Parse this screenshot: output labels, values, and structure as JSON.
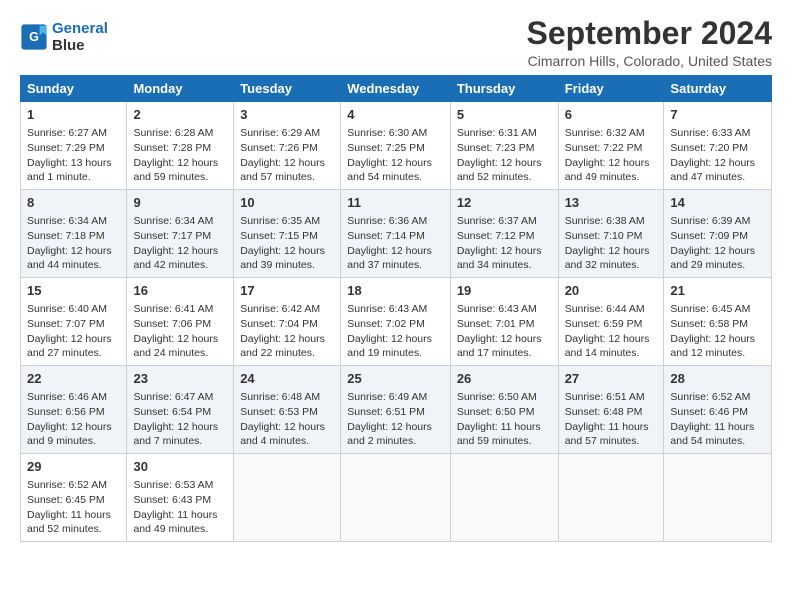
{
  "header": {
    "logo_line1": "General",
    "logo_line2": "Blue",
    "month_title": "September 2024",
    "subtitle": "Cimarron Hills, Colorado, United States"
  },
  "weekdays": [
    "Sunday",
    "Monday",
    "Tuesday",
    "Wednesday",
    "Thursday",
    "Friday",
    "Saturday"
  ],
  "weeks": [
    [
      {
        "day": "1",
        "info": "Sunrise: 6:27 AM\nSunset: 7:29 PM\nDaylight: 13 hours\nand 1 minute."
      },
      {
        "day": "2",
        "info": "Sunrise: 6:28 AM\nSunset: 7:28 PM\nDaylight: 12 hours\nand 59 minutes."
      },
      {
        "day": "3",
        "info": "Sunrise: 6:29 AM\nSunset: 7:26 PM\nDaylight: 12 hours\nand 57 minutes."
      },
      {
        "day": "4",
        "info": "Sunrise: 6:30 AM\nSunset: 7:25 PM\nDaylight: 12 hours\nand 54 minutes."
      },
      {
        "day": "5",
        "info": "Sunrise: 6:31 AM\nSunset: 7:23 PM\nDaylight: 12 hours\nand 52 minutes."
      },
      {
        "day": "6",
        "info": "Sunrise: 6:32 AM\nSunset: 7:22 PM\nDaylight: 12 hours\nand 49 minutes."
      },
      {
        "day": "7",
        "info": "Sunrise: 6:33 AM\nSunset: 7:20 PM\nDaylight: 12 hours\nand 47 minutes."
      }
    ],
    [
      {
        "day": "8",
        "info": "Sunrise: 6:34 AM\nSunset: 7:18 PM\nDaylight: 12 hours\nand 44 minutes."
      },
      {
        "day": "9",
        "info": "Sunrise: 6:34 AM\nSunset: 7:17 PM\nDaylight: 12 hours\nand 42 minutes."
      },
      {
        "day": "10",
        "info": "Sunrise: 6:35 AM\nSunset: 7:15 PM\nDaylight: 12 hours\nand 39 minutes."
      },
      {
        "day": "11",
        "info": "Sunrise: 6:36 AM\nSunset: 7:14 PM\nDaylight: 12 hours\nand 37 minutes."
      },
      {
        "day": "12",
        "info": "Sunrise: 6:37 AM\nSunset: 7:12 PM\nDaylight: 12 hours\nand 34 minutes."
      },
      {
        "day": "13",
        "info": "Sunrise: 6:38 AM\nSunset: 7:10 PM\nDaylight: 12 hours\nand 32 minutes."
      },
      {
        "day": "14",
        "info": "Sunrise: 6:39 AM\nSunset: 7:09 PM\nDaylight: 12 hours\nand 29 minutes."
      }
    ],
    [
      {
        "day": "15",
        "info": "Sunrise: 6:40 AM\nSunset: 7:07 PM\nDaylight: 12 hours\nand 27 minutes."
      },
      {
        "day": "16",
        "info": "Sunrise: 6:41 AM\nSunset: 7:06 PM\nDaylight: 12 hours\nand 24 minutes."
      },
      {
        "day": "17",
        "info": "Sunrise: 6:42 AM\nSunset: 7:04 PM\nDaylight: 12 hours\nand 22 minutes."
      },
      {
        "day": "18",
        "info": "Sunrise: 6:43 AM\nSunset: 7:02 PM\nDaylight: 12 hours\nand 19 minutes."
      },
      {
        "day": "19",
        "info": "Sunrise: 6:43 AM\nSunset: 7:01 PM\nDaylight: 12 hours\nand 17 minutes."
      },
      {
        "day": "20",
        "info": "Sunrise: 6:44 AM\nSunset: 6:59 PM\nDaylight: 12 hours\nand 14 minutes."
      },
      {
        "day": "21",
        "info": "Sunrise: 6:45 AM\nSunset: 6:58 PM\nDaylight: 12 hours\nand 12 minutes."
      }
    ],
    [
      {
        "day": "22",
        "info": "Sunrise: 6:46 AM\nSunset: 6:56 PM\nDaylight: 12 hours\nand 9 minutes."
      },
      {
        "day": "23",
        "info": "Sunrise: 6:47 AM\nSunset: 6:54 PM\nDaylight: 12 hours\nand 7 minutes."
      },
      {
        "day": "24",
        "info": "Sunrise: 6:48 AM\nSunset: 6:53 PM\nDaylight: 12 hours\nand 4 minutes."
      },
      {
        "day": "25",
        "info": "Sunrise: 6:49 AM\nSunset: 6:51 PM\nDaylight: 12 hours\nand 2 minutes."
      },
      {
        "day": "26",
        "info": "Sunrise: 6:50 AM\nSunset: 6:50 PM\nDaylight: 11 hours\nand 59 minutes."
      },
      {
        "day": "27",
        "info": "Sunrise: 6:51 AM\nSunset: 6:48 PM\nDaylight: 11 hours\nand 57 minutes."
      },
      {
        "day": "28",
        "info": "Sunrise: 6:52 AM\nSunset: 6:46 PM\nDaylight: 11 hours\nand 54 minutes."
      }
    ],
    [
      {
        "day": "29",
        "info": "Sunrise: 6:52 AM\nSunset: 6:45 PM\nDaylight: 11 hours\nand 52 minutes."
      },
      {
        "day": "30",
        "info": "Sunrise: 6:53 AM\nSunset: 6:43 PM\nDaylight: 11 hours\nand 49 minutes."
      },
      {
        "day": "",
        "info": ""
      },
      {
        "day": "",
        "info": ""
      },
      {
        "day": "",
        "info": ""
      },
      {
        "day": "",
        "info": ""
      },
      {
        "day": "",
        "info": ""
      }
    ]
  ]
}
